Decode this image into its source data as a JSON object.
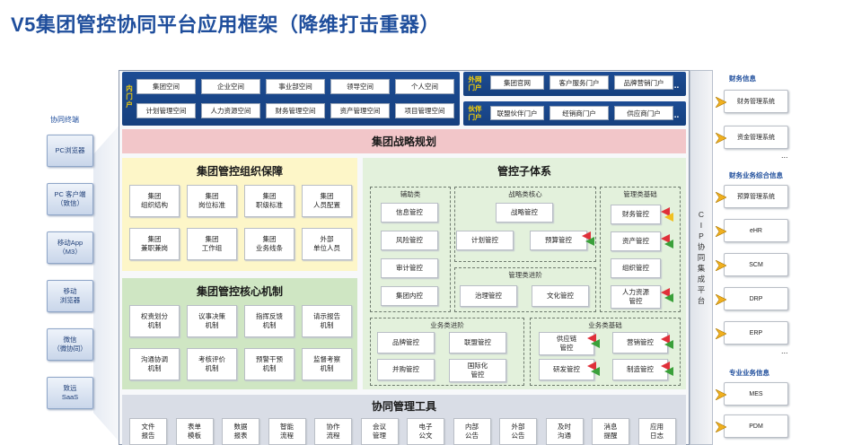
{
  "title": "V5集团管控协同平台应用框架（降维打击重器）",
  "left": {
    "label": "协同终端",
    "clients": [
      "PC浏览器",
      "PC 客户端\n（致信）",
      "移动App\n（M3）",
      "移动\n浏览器",
      "微信\n（微协同）",
      "致远\nSaaS"
    ]
  },
  "inner_portal": {
    "label": "内门户",
    "row1": [
      "集团空间",
      "企业空间",
      "事业部空间",
      "领导空间",
      "个人空间"
    ],
    "row2": [
      "计划管理空间",
      "人力资源空间",
      "财务管理空间",
      "资产管理空间",
      "项目管理空间"
    ]
  },
  "outer_portal": {
    "label": "外网门户",
    "items": [
      "集团官网",
      "客户服务门户",
      "品牌营销门户"
    ],
    "dots": "..."
  },
  "partner_portal": {
    "label": "伙伴门户",
    "items": [
      "联盟伙伴门户",
      "经销商门户",
      "供应商门户"
    ],
    "dots": "..."
  },
  "strategy": "集团战略规划",
  "org": {
    "title": "集团管控组织保障",
    "items": [
      "集团\n组织结构",
      "集团\n岗位标准",
      "集团\n职级标准",
      "集团\n人员配置",
      "集团\n兼职兼岗",
      "集团\n工作组",
      "集团\n业务线条",
      "外部\n单位人员"
    ]
  },
  "core": {
    "title": "集团管控核心机制",
    "items": [
      "权责划分\n机制",
      "议事决策\n机制",
      "指挥反馈\n机制",
      "请示报告\n机制",
      "沟通协调\n机制",
      "考核评价\n机制",
      "预警干预\n机制",
      "监督考察\n机制"
    ]
  },
  "sub": {
    "title": "管控子体系",
    "aux": {
      "title": "辅助类",
      "items": [
        "信息管控",
        "风险管控",
        "审计管控",
        "集团内控"
      ]
    },
    "strategic": {
      "title": "战略类核心",
      "items": [
        "战略管控",
        "计划管控",
        "预算管控"
      ]
    },
    "mgmt_base": {
      "title": "管理类基础",
      "items": [
        "财务管控",
        "资产管控",
        "组织管控",
        "人力资源\n管控"
      ]
    },
    "mgmt_adv": {
      "title": "管理类进阶",
      "items": [
        "治理管控",
        "文化管控"
      ]
    },
    "biz_adv": {
      "title": "业务类进阶",
      "items": [
        "品牌管控",
        "联盟管控",
        "并购管控",
        "国际化\n管控"
      ]
    },
    "biz_base": {
      "title": "业务类基础",
      "items": [
        "供应链\n管控",
        "营销管控",
        "研发管控",
        "制造管控"
      ]
    }
  },
  "collab": {
    "title": "协同管理工具",
    "items": [
      "文件\n报告",
      "表单\n模板",
      "数据\n报表",
      "智能\n流程",
      "协作\n流程",
      "会议\n管理",
      "电子\n公文",
      "内部\n公告",
      "外部\n公告",
      "及时\n沟通",
      "消息\n提醒",
      "应用\n日志"
    ]
  },
  "cip": "CIP协同集成平台",
  "right": {
    "finance_info": {
      "label": "财务信息",
      "items": [
        "财务管理系统",
        "资金管理系统"
      ]
    },
    "finance_biz": {
      "label": "财务业务综合信息",
      "items": [
        "预算管理系统",
        "eHR",
        "SCM",
        "DRP",
        "ERP"
      ]
    },
    "pro_biz": {
      "label": "专业业务信息",
      "items": [
        "MES",
        "PDM"
      ]
    },
    "dots": "..."
  },
  "colors": {
    "title": "#1f4e9c",
    "portal": "#1c4c94",
    "strategy": "#f2c6c9",
    "org": "#fdf6c8",
    "core": "#cfe6c3",
    "sub": "#e3f1dc",
    "collab": "#d9dde6",
    "flag_red": "#e0303a",
    "flag_yellow": "#f0c020",
    "flag_green": "#3aa03a"
  }
}
